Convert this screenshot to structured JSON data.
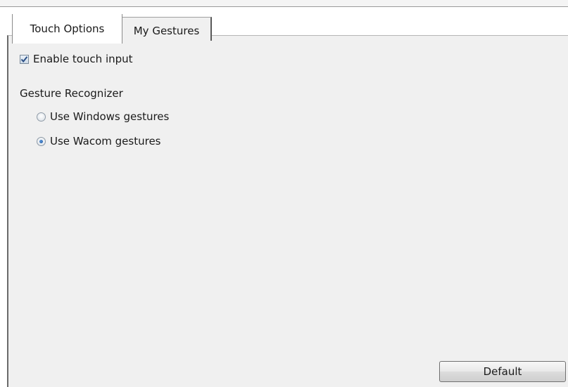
{
  "tabs": [
    {
      "label": "Touch Options",
      "selected": true
    },
    {
      "label": "My Gestures",
      "selected": false
    }
  ],
  "touch": {
    "enable_label": "Enable touch input",
    "enable_checked": true
  },
  "gesture_recognizer": {
    "heading": "Gesture Recognizer",
    "options": [
      {
        "label": "Use Windows gestures",
        "selected": false
      },
      {
        "label": "Use Wacom gestures",
        "selected": true
      }
    ]
  },
  "buttons": {
    "default_label": "Default"
  },
  "colors": {
    "panel_background": "#f0f0f0",
    "radio_dot": "#1c4f94",
    "checkmark": "#2b4f86"
  }
}
